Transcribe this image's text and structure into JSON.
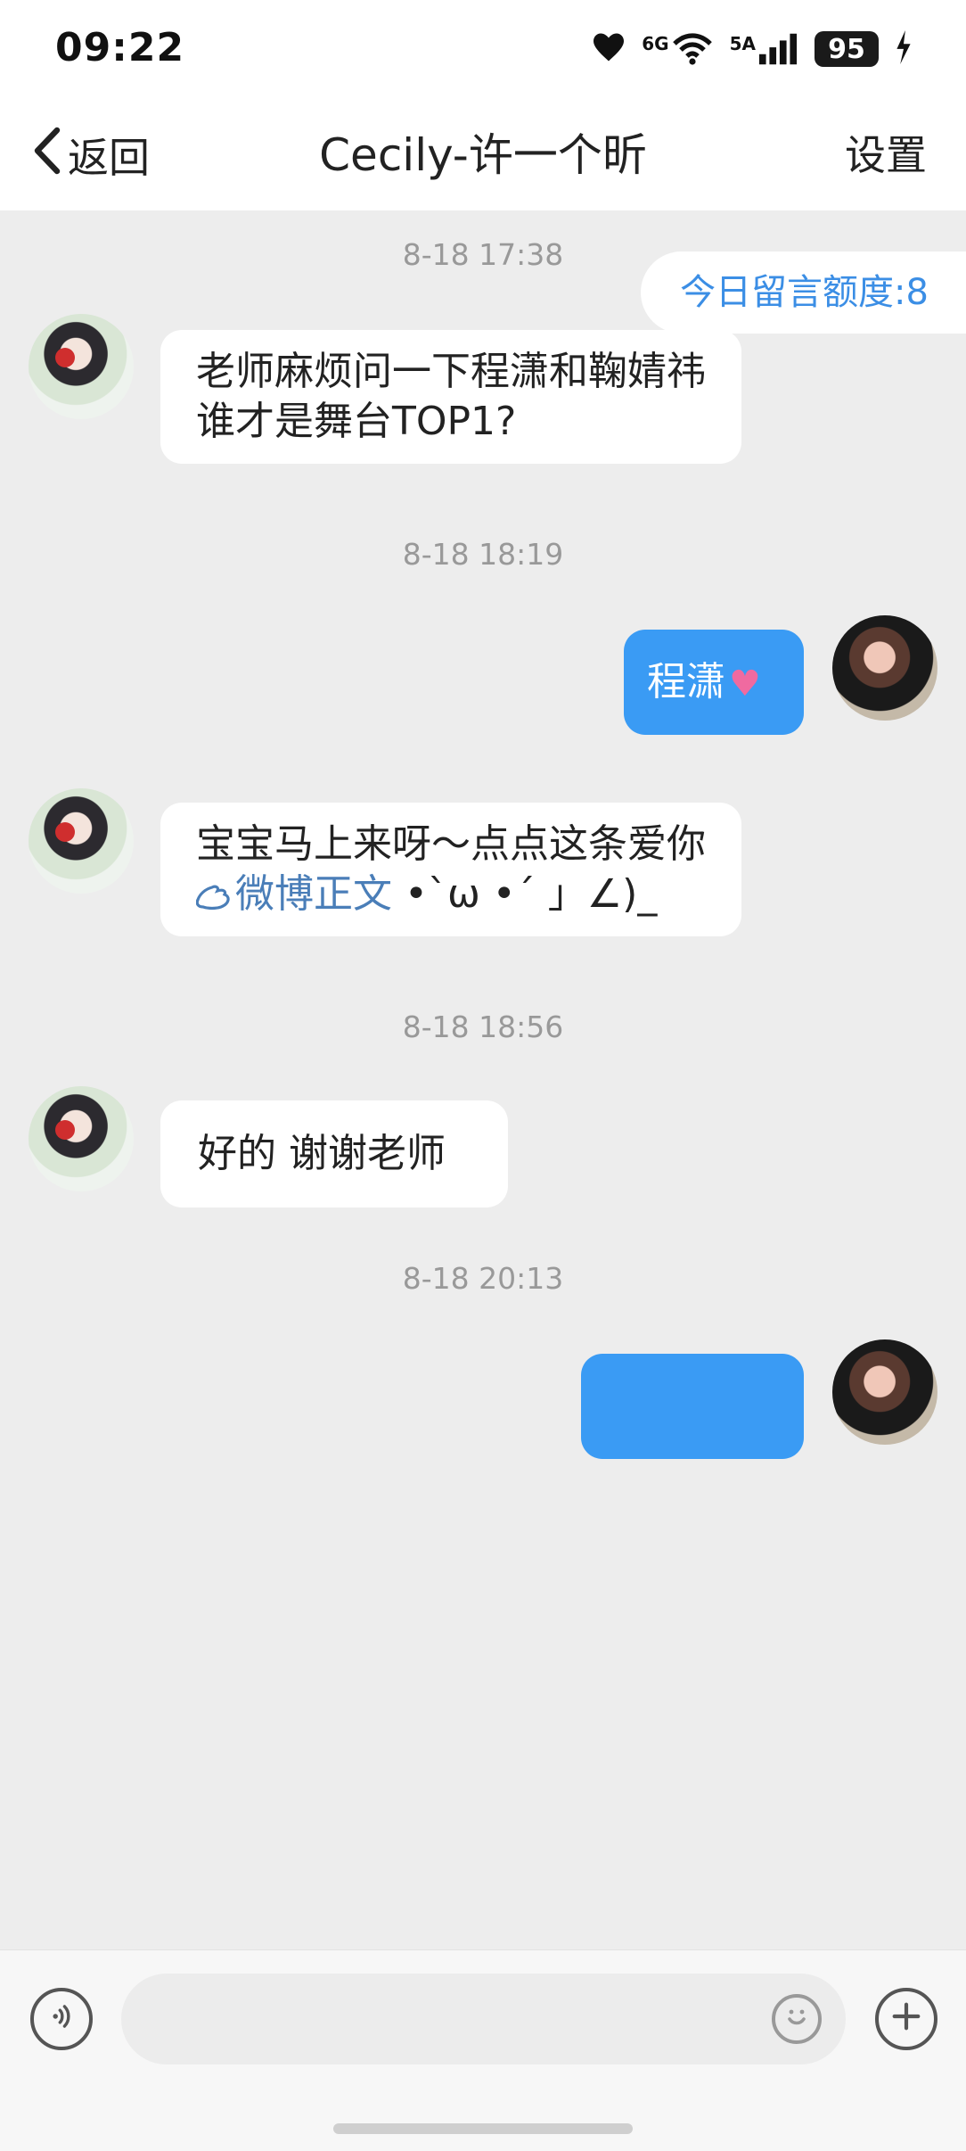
{
  "status_bar": {
    "time": "09:22",
    "network_6g": "6G",
    "network_5a": "5A",
    "battery": "95"
  },
  "nav": {
    "back": "返回",
    "title": "Cecily-许一个昕",
    "settings": "设置"
  },
  "quota": {
    "label": "今日留言额度:8"
  },
  "messages": [
    {
      "timestamp": "8-18 17:38",
      "from": "other",
      "text": "老师麻烦问一下程潇和鞠婧祎谁才是舞台TOP1?"
    },
    {
      "timestamp": "8-18 18:19",
      "from": "self",
      "text": "程潇",
      "emoji": "heart"
    },
    {
      "from": "other",
      "text_prefix": "宝宝马上来呀～点点这条爱你",
      "link_text": "微博正文",
      "text_suffix": " •`ω •´ 」∠)_"
    },
    {
      "timestamp": "8-18 18:56",
      "from": "other",
      "text": "好的  谢谢老师"
    },
    {
      "timestamp": "8-18 20:13",
      "from": "self",
      "text": ""
    }
  ],
  "input": {
    "placeholder": ""
  },
  "colors": {
    "accent": "#3a9bf4",
    "background": "#ededed",
    "link": "#4a7eb8"
  }
}
